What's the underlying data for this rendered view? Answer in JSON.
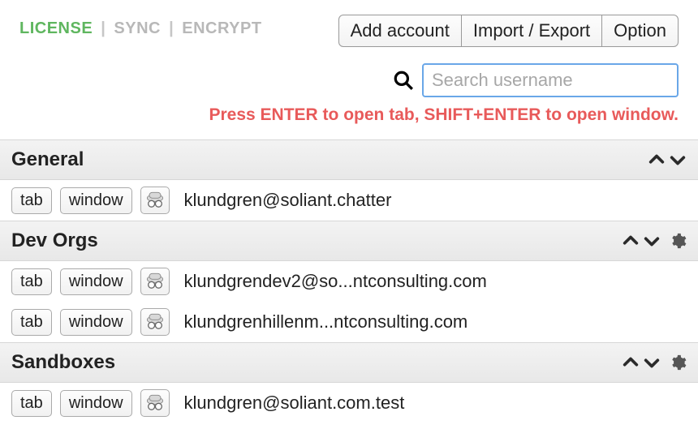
{
  "topLinks": {
    "license": "LICENSE",
    "sync": "SYNC",
    "encrypt": "ENCRYPT"
  },
  "topButtons": {
    "addAccount": "Add account",
    "importExport": "Import / Export",
    "option": "Option"
  },
  "search": {
    "placeholder": "Search username"
  },
  "hint": "Press ENTER to open tab, SHIFT+ENTER to open window.",
  "rowButtons": {
    "tab": "tab",
    "window": "window"
  },
  "sections": [
    {
      "title": "General",
      "hasGear": false,
      "items": [
        {
          "username": "klundgren@soliant.chatter"
        }
      ]
    },
    {
      "title": "Dev Orgs",
      "hasGear": true,
      "items": [
        {
          "username": "klundgrendev2@so...ntconsulting.com"
        },
        {
          "username": "klundgrenhillenm...ntconsulting.com"
        }
      ]
    },
    {
      "title": "Sandboxes",
      "hasGear": true,
      "items": [
        {
          "username": "klundgren@soliant.com.test"
        }
      ]
    }
  ]
}
